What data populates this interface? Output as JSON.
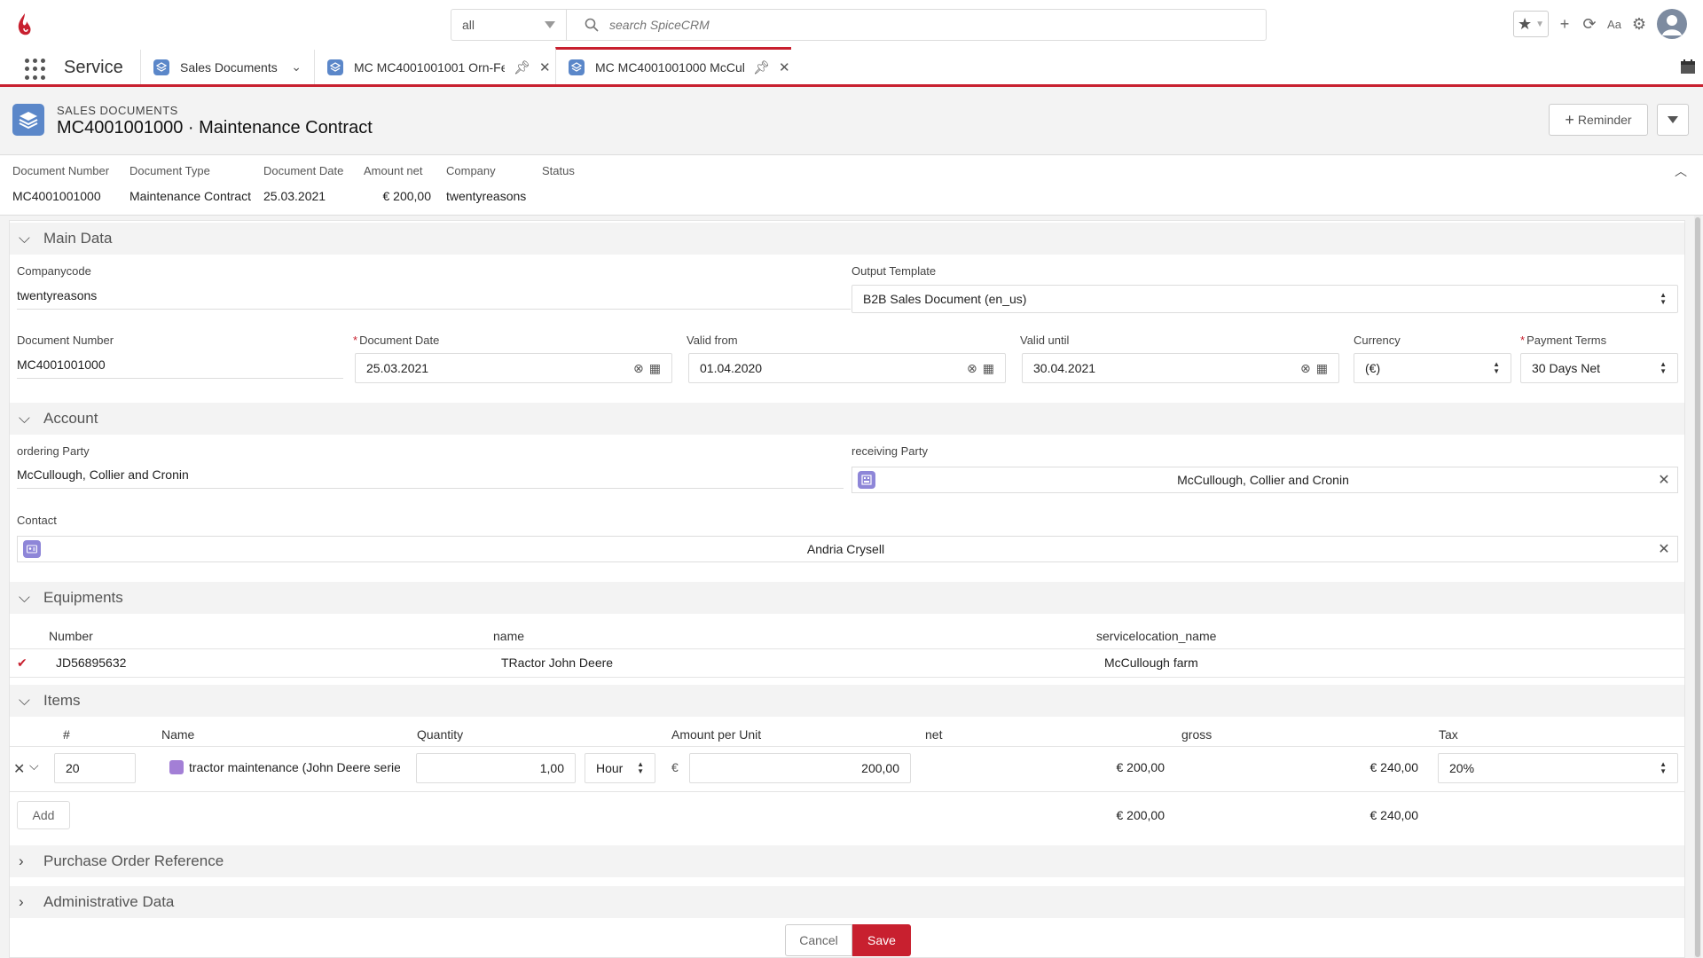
{
  "header": {
    "search_scope": "all",
    "search_placeholder": "search SpiceCRM"
  },
  "nav": {
    "app_name": "Service",
    "tabs": [
      {
        "label": "Sales Documents"
      },
      {
        "label": "MC MC4001001001 Orn-Fe"
      },
      {
        "label": "MC MC4001001000 McCull"
      }
    ]
  },
  "page": {
    "module": "SALES DOCUMENTS",
    "title": "MC4001001000 · Maintenance Contract",
    "reminder_label": "Reminder"
  },
  "highlights": [
    {
      "key": "Document Number",
      "value": "MC4001001000"
    },
    {
      "key": "Document Type",
      "value": "Maintenance Contract"
    },
    {
      "key": "Document Date",
      "value": "25.03.2021"
    },
    {
      "key": "Amount net",
      "value": "€ 200,00"
    },
    {
      "key": "Company",
      "value": "twentyreasons"
    },
    {
      "key": "Status",
      "value": ""
    }
  ],
  "main_data": {
    "section": "Main Data",
    "companycode_label": "Companycode",
    "companycode": "twentyreasons",
    "output_template_label": "Output Template",
    "output_template": "B2B Sales Document (en_us)",
    "doc_number_label": "Document Number",
    "doc_number": "MC4001001000",
    "doc_date_label": "Document Date",
    "doc_date": "25.03.2021",
    "valid_from_label": "Valid from",
    "valid_from": "01.04.2020",
    "valid_until_label": "Valid until",
    "valid_until": "30.04.2021",
    "currency_label": "Currency",
    "currency": "(€)",
    "payment_terms_label": "Payment Terms",
    "payment_terms": "30 Days Net"
  },
  "account": {
    "section": "Account",
    "ordering_label": "ordering Party",
    "ordering": "McCullough, Collier and Cronin",
    "receiving_label": "receiving Party",
    "receiving": "McCullough, Collier and Cronin",
    "contact_label": "Contact",
    "contact": "Andria Crysell"
  },
  "equipments": {
    "section": "Equipments",
    "headers": {
      "number": "Number",
      "name": "name",
      "location": "servicelocation_name"
    },
    "rows": [
      {
        "number": "JD56895632",
        "name": "TRactor John Deere",
        "location": "McCullough farm"
      }
    ]
  },
  "items": {
    "section": "Items",
    "headers": {
      "pos": "#",
      "name": "Name",
      "quantity": "Quantity",
      "amount": "Amount per Unit",
      "net": "net",
      "gross": "gross",
      "tax": "Tax"
    },
    "rows": [
      {
        "pos": "20",
        "name": "tractor maintenance (John Deere serie:",
        "quantity": "1,00",
        "unit": "Hour",
        "currency_symbol": "€",
        "amount": "200,00",
        "net": "€ 200,00",
        "gross": "€ 240,00",
        "tax": "20%"
      }
    ],
    "add_label": "Add",
    "total_net": "€ 200,00",
    "total_gross": "€ 240,00"
  },
  "collapsed_sections": {
    "purchase_order": "Purchase Order Reference",
    "administrative": "Administrative Data"
  },
  "actions": {
    "cancel": "Cancel",
    "save": "Save"
  },
  "colors": {
    "accent": "#c8202f",
    "module_icon": "#5b87c9",
    "lookup_icon": "#8e86d8"
  }
}
